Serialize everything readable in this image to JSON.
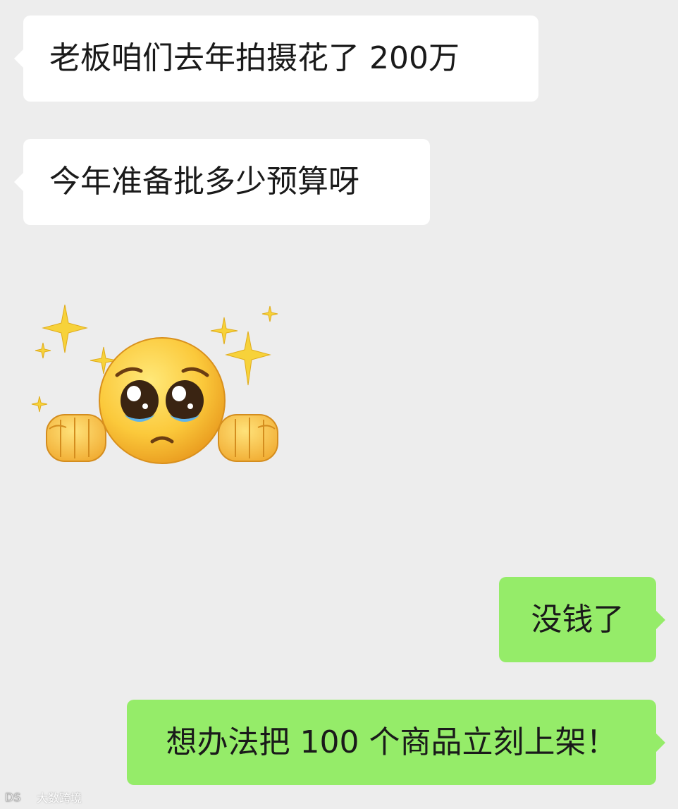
{
  "messages": [
    {
      "direction": "incoming",
      "text": "老板咱们去年拍摄花了 200万"
    },
    {
      "direction": "incoming",
      "text": "今年准备批多少预算呀"
    },
    {
      "direction": "outgoing",
      "text": "没钱了"
    },
    {
      "direction": "outgoing",
      "text": "想办法把 100 个商品立刻上架！"
    }
  ],
  "sticker": {
    "icon": "pleading-face-fists-sparkles-icon"
  },
  "watermark": {
    "text": "大数跨境"
  },
  "colors": {
    "background": "#ededed",
    "incoming_bubble": "#ffffff",
    "outgoing_bubble": "#95ec69",
    "text": "#1a1a1a"
  }
}
